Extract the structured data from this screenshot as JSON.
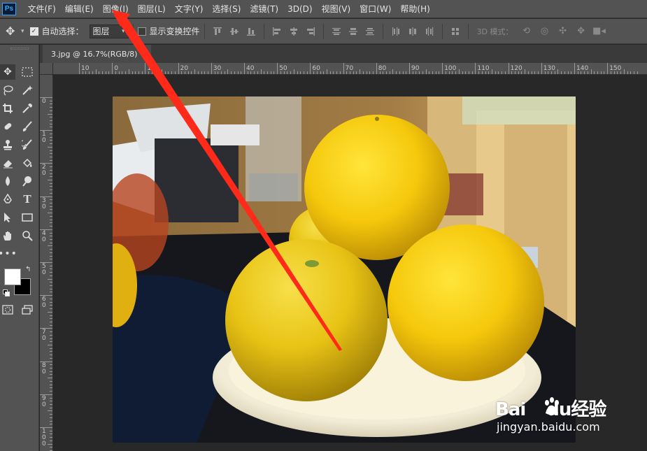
{
  "app": {
    "logo_text": "Ps"
  },
  "menu": [
    "文件(F)",
    "编辑(E)",
    "图像(I)",
    "图层(L)",
    "文字(Y)",
    "选择(S)",
    "滤镜(T)",
    "3D(D)",
    "视图(V)",
    "窗口(W)",
    "帮助(H)"
  ],
  "options": {
    "auto_select_label": "自动选择：",
    "auto_select_checked": true,
    "auto_select_target": "图层",
    "show_transform_label": "显示变换控件",
    "show_transform_checked": false,
    "mode_3d_label": "3D 模式："
  },
  "document": {
    "tab_title": "3.jpg @ 16.7%(RGB/8)",
    "close_glyph": "×"
  },
  "ruler_h": [
    "10",
    "0",
    "10",
    "20",
    "30",
    "40",
    "50",
    "60",
    "70",
    "80",
    "90",
    "100",
    "110",
    "120",
    "130",
    "140",
    "150"
  ],
  "ruler_v": [
    "0",
    "10",
    "20",
    "30",
    "40",
    "50",
    "60",
    "70",
    "80",
    "90",
    "100"
  ],
  "colors": {
    "foreground": "#ffffff",
    "background": "#000000",
    "annotation_arrow": "#ff2a1a"
  },
  "watermark": {
    "logo_left": "Bai",
    "logo_right": "du",
    "logo_suffix": "经验",
    "url": "jingyan.baidu.com"
  }
}
